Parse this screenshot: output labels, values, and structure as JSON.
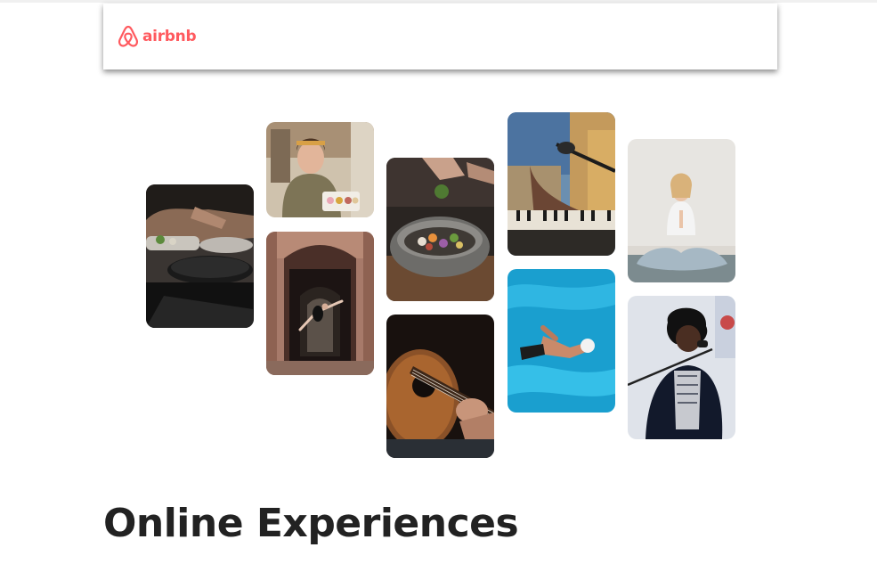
{
  "navbar": {
    "logo_text": "airbnb",
    "logo_icon": "airbnb-belo-icon",
    "brand_color": "#FF5A5F"
  },
  "photos": [
    {
      "name": "cooking-pans-photo",
      "subject": "hands cooking with pans"
    },
    {
      "name": "woman-macarons-photo",
      "subject": "woman holding tray of macarons"
    },
    {
      "name": "dancer-archway-photo",
      "subject": "dancer leaping under stone archway"
    },
    {
      "name": "food-bowl-photo",
      "subject": "garnishing a bowl of food"
    },
    {
      "name": "guitar-photo",
      "subject": "acoustic guitar being played"
    },
    {
      "name": "piano-microphone-photo",
      "subject": "keyboard and microphone"
    },
    {
      "name": "swimmer-photo",
      "subject": "swimmer in blue pool"
    },
    {
      "name": "yoga-photo",
      "subject": "woman meditating in yoga pose"
    },
    {
      "name": "singer-photo",
      "subject": "singer at microphone stand"
    }
  ],
  "hero": {
    "title": "Online Experiences"
  }
}
